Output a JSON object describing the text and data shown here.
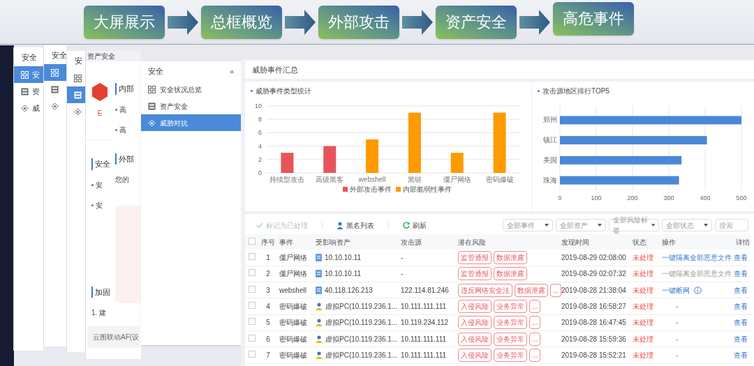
{
  "flow_steps": [
    "大屏展示",
    "总框概览",
    "外部攻击",
    "资产安全",
    "高危事件"
  ],
  "background_windows": [
    {
      "header": "安全",
      "items": [
        {
          "label": "安",
          "selected": true
        },
        {
          "label": "资",
          "selected": false
        },
        {
          "label": "威",
          "selected": false
        }
      ]
    },
    {
      "header": "安全",
      "items": [
        {
          "selected": true
        },
        {
          "selected": false
        },
        {
          "selected": false
        }
      ]
    },
    {
      "header": "安",
      "items": [
        {
          "selected": false
        },
        {
          "selected": true
        },
        {
          "selected": false
        }
      ]
    }
  ],
  "asset_page": {
    "tab": "资产安全",
    "logo_caption": "E",
    "blocks": [
      {
        "kind": "heading",
        "text": "安全"
      },
      {
        "kind": "bullet",
        "text": "安"
      },
      {
        "kind": "bullet",
        "text": "安"
      },
      {
        "kind": "heading",
        "text": "加固"
      },
      {
        "kind": "text",
        "text": "1. 建"
      },
      {
        "kind": "box",
        "text": "云图联动AF(设"
      }
    ]
  },
  "overview_page": {
    "blocks": [
      {
        "kind": "heading",
        "text": "内部"
      },
      {
        "kind": "bullet",
        "text": "高"
      },
      {
        "kind": "bullet",
        "text": "高"
      },
      {
        "kind": "heading",
        "text": "外部"
      },
      {
        "kind": "text",
        "text": "您的"
      },
      {
        "kind": "box"
      }
    ]
  },
  "sidebar": {
    "title": "安全",
    "collapse": "«",
    "items": [
      {
        "label": "安全状况总览",
        "selected": false
      },
      {
        "label": "资产安全",
        "selected": false
      },
      {
        "label": "威胁对抗",
        "selected": true
      }
    ]
  },
  "main": {
    "title": "威胁事件汇总",
    "type_chart": {
      "title": "威胁事件类型统计",
      "chart_data": {
        "type": "bar",
        "categories": [
          "持续型攻击",
          "高级黑客",
          "webshell",
          "黑链",
          "僵尸网络",
          "密码爆破"
        ],
        "series": [
          {
            "name": "外部攻击事件",
            "color": "#e9545b",
            "values": [
              3,
              4,
              null,
              null,
              null,
              null
            ]
          },
          {
            "name": "内部脆弱性事件",
            "color": "#ff9a00",
            "values": [
              null,
              null,
              5,
              9,
              3,
              9
            ]
          }
        ],
        "ylim": [
          0,
          10
        ],
        "yticks": [
          0,
          2,
          4,
          6,
          8,
          10
        ],
        "grid": true,
        "legend": true
      }
    },
    "region_chart": {
      "title": "攻击源地区排行TOP5",
      "chart_data": {
        "type": "bar",
        "orientation": "horizontal",
        "categories": [
          "郑州",
          "镇江",
          "美国",
          "珠海"
        ],
        "series": [
          {
            "color": "#4a88d6",
            "values": [
              500,
              405,
              335,
              328
            ]
          }
        ],
        "xlim": [
          0,
          500
        ],
        "xticks": [
          0,
          100,
          200,
          300,
          400,
          500
        ],
        "grid": true
      }
    },
    "toolbar": [
      {
        "kind": "mark",
        "label": "标记为已处理",
        "disabled": true
      },
      {
        "kind": "list",
        "label": "黑名列表",
        "disabled": false
      },
      {
        "kind": "refresh",
        "label": "刷新",
        "disabled": false
      }
    ],
    "filters": [
      "全部事件",
      "全部资产",
      "全部风险标签",
      "全部状态"
    ],
    "search": {
      "placeholder": "搜索"
    },
    "table": {
      "checked": false,
      "columns": [
        "序号",
        "事件",
        "受影响资产",
        "攻击源",
        "潜在风险",
        "发现时间",
        "状态",
        "操作",
        "详情"
      ],
      "rows": [
        {
          "checked": false,
          "no": "1",
          "event": "僵尸网络",
          "asset": {
            "kind": "server",
            "text": "10.10.10.11"
          },
          "source": "-",
          "risks": [
            "监管通报",
            "数据泄露"
          ],
          "time": "2019-08-29 02:08:00",
          "status": "未处理",
          "action": {
            "kind": "link",
            "text": "一键隔离全部恶意文件"
          },
          "detail": "查看"
        },
        {
          "checked": false,
          "no": "2",
          "event": "僵尸网络",
          "asset": {
            "kind": "server",
            "text": "10.10.10.11"
          },
          "source": "-",
          "risks": [
            "监管通报",
            "数据泄露"
          ],
          "time": "2019-08-29 02:07:32",
          "status": "未处理",
          "action": {
            "kind": "disabled",
            "text": "一键隔离全部恶意文件"
          },
          "detail": "查看"
        },
        {
          "checked": false,
          "no": "3",
          "event": "webshell",
          "asset": {
            "kind": "server",
            "text": "40.118.126.213"
          },
          "source": "122.114.81.246",
          "risks": [
            "违反网络安全法",
            "数据泄露",
            "..."
          ],
          "time": "2019-08-28 21:38:04",
          "status": "未处理",
          "action": {
            "kind": "link_info",
            "text": "一键断网"
          },
          "detail": "查看"
        },
        {
          "checked": false,
          "no": "4",
          "event": "密码爆破",
          "asset": {
            "kind": "pc",
            "text": "虚拟PC(10.119.236.1..."
          },
          "source": "10.111.111.111",
          "risks": [
            "入侵风险",
            "业务异常",
            "..."
          ],
          "time": "2019-08-28 16:58:27",
          "status": "未处理",
          "action": {
            "kind": "plain",
            "text": "-"
          },
          "detail": "查看"
        },
        {
          "checked": false,
          "no": "5",
          "event": "密码爆破",
          "asset": {
            "kind": "pc",
            "text": "虚拟PC(10.119.236.1..."
          },
          "source": "10.119.234.112",
          "risks": [
            "入侵风险",
            "业务异常",
            "..."
          ],
          "time": "2019-08-28 16:47:45",
          "status": "未处理",
          "action": {
            "kind": "plain",
            "text": "-"
          },
          "detail": "查看"
        },
        {
          "checked": false,
          "no": "6",
          "event": "密码爆破",
          "asset": {
            "kind": "pc",
            "text": "虚拟PC(10.119.236.1..."
          },
          "source": "10.111.111.111",
          "risks": [
            "入侵风险",
            "业务异常",
            "..."
          ],
          "time": "2019-08-28 15:59:36",
          "status": "未处理",
          "action": {
            "kind": "plain",
            "text": "-"
          },
          "detail": "查看"
        },
        {
          "checked": false,
          "no": "7",
          "event": "密码爆破",
          "asset": {
            "kind": "pc",
            "text": "虚拟PC(10.119.236.1..."
          },
          "source": "10.111.111.111",
          "risks": [
            "入侵风险",
            "业务异常",
            "..."
          ],
          "time": "2019-08-28 15:52:21",
          "status": "未处理",
          "action": {
            "kind": "plain",
            "text": "-"
          },
          "detail": "查看"
        }
      ]
    }
  }
}
